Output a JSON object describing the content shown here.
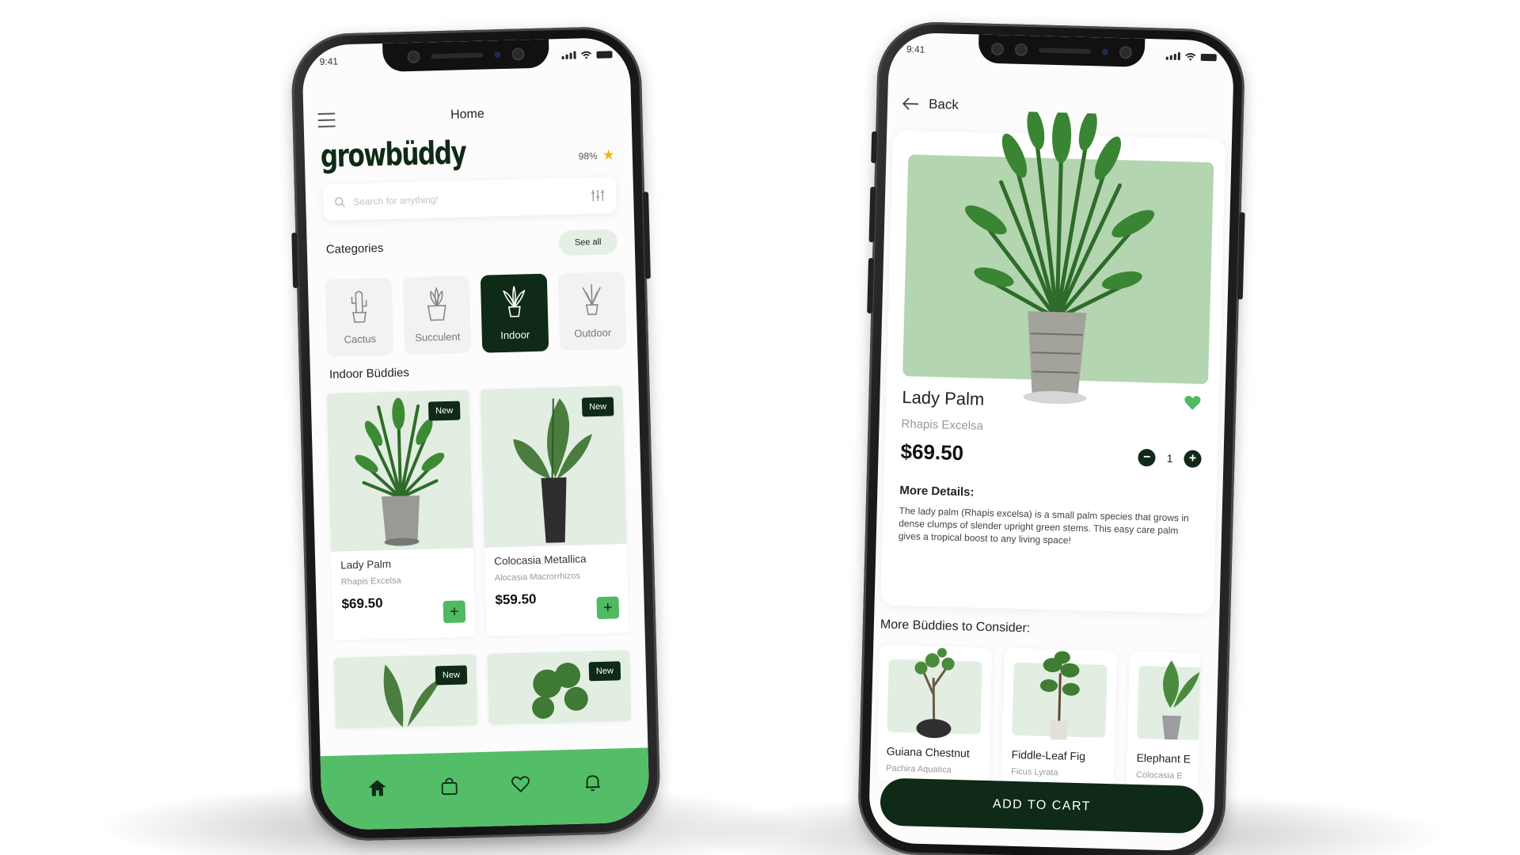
{
  "colors": {
    "brand_dark": "#0f2a16",
    "brand_green": "#54bd68",
    "plus_green": "#4fba61",
    "hero_bg": "#b3d5af",
    "card_bg": "#e2eee2",
    "star": "#f4b21f"
  },
  "left_phone": {
    "status_time": "9:41",
    "header_title": "Home",
    "brand": "growbüddy",
    "rating": "98%",
    "search_placeholder": "Search for anything!",
    "categories_title": "Categories",
    "see_all": "See all",
    "categories": [
      {
        "label": "Cactus",
        "icon": "cactus-icon"
      },
      {
        "label": "Succulent",
        "icon": "succulent-icon"
      },
      {
        "label": "Indoor",
        "icon": "indoor-plant-icon"
      },
      {
        "label": "Outdoor",
        "icon": "outdoor-plant-icon"
      }
    ],
    "section_title": "Indoor Büddies",
    "products": [
      {
        "badge": "New",
        "name": "Lady Palm",
        "latin": "Rhapis Excelsa",
        "price": "$69.50"
      },
      {
        "badge": "New",
        "name": "Colocasia Metallica",
        "latin": "Alocasia Macrorrhizos",
        "price": "$59.50"
      },
      {
        "badge": "New"
      },
      {
        "badge": "New"
      }
    ],
    "tabs": [
      "home-icon",
      "bag-icon",
      "heart-icon",
      "bell-icon"
    ]
  },
  "right_phone": {
    "status_time": "9:41",
    "back": "Back",
    "name": "Lady Palm",
    "latin": "Rhapis Excelsa",
    "price": "$69.50",
    "quantity": "1",
    "more_details_title": "More Details:",
    "more_details_text": "The lady palm (Rhapis excelsa) is a small palm species that grows in dense clumps of slender upright green stems. This easy care palm gives a tropical boost to any living space!",
    "consider_title": "More Büddies to Consider:",
    "suggestions": [
      {
        "name": "Guiana Chestnut",
        "latin": "Pachira Aquatica"
      },
      {
        "name": "Fiddle-Leaf Fig",
        "latin": "Ficus Lyrata"
      },
      {
        "name": "Elephant E",
        "latin": "Colocasia E"
      }
    ],
    "add_to_cart": "ADD TO CART"
  }
}
